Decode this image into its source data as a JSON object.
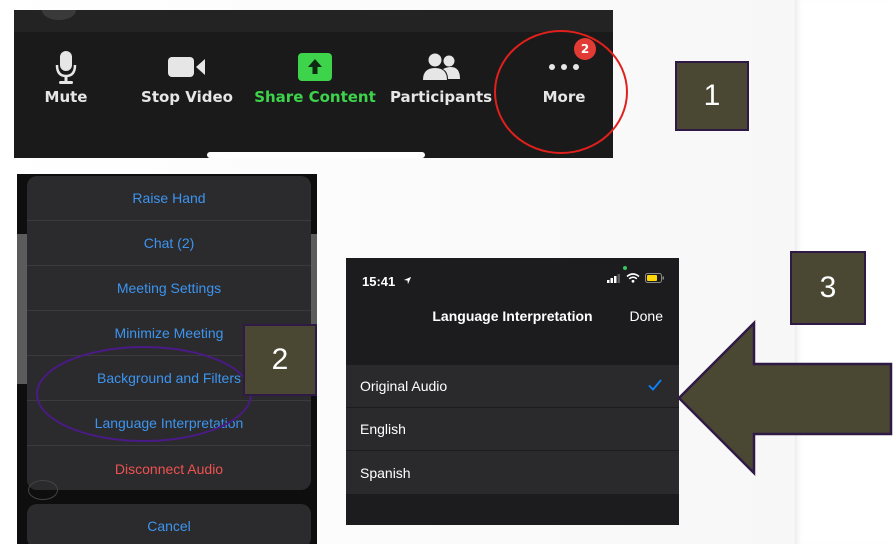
{
  "toolbar": {
    "items": [
      {
        "label": "Mute",
        "icon": "microphone-icon"
      },
      {
        "label": "Stop Video",
        "icon": "video-camera-icon"
      },
      {
        "label": "Share Content",
        "icon": "share-screen-icon"
      },
      {
        "label": "Participants",
        "icon": "people-icon"
      },
      {
        "label": "More",
        "icon": "ellipsis-icon"
      }
    ],
    "badge_count": "2",
    "share_color": "#3dd44c",
    "highlight_color": "#e0201c"
  },
  "steps": {
    "one": "1",
    "two": "2",
    "three": "3"
  },
  "more_menu": {
    "items": [
      "Raise Hand",
      "Chat (2)",
      "Meeting Settings",
      "Minimize Meeting",
      "Background and Filters",
      "Language Interpretation",
      "Disconnect Audio"
    ],
    "cancel": "Cancel",
    "link_color": "#3d94ef",
    "danger_color": "#ee5250"
  },
  "language_screen": {
    "time": "15:41",
    "title": "Language Interpretation",
    "done": "Done",
    "options": [
      "Original Audio",
      "English",
      "Spanish"
    ],
    "selected_index": 0,
    "accent_color": "#0a84ff"
  }
}
